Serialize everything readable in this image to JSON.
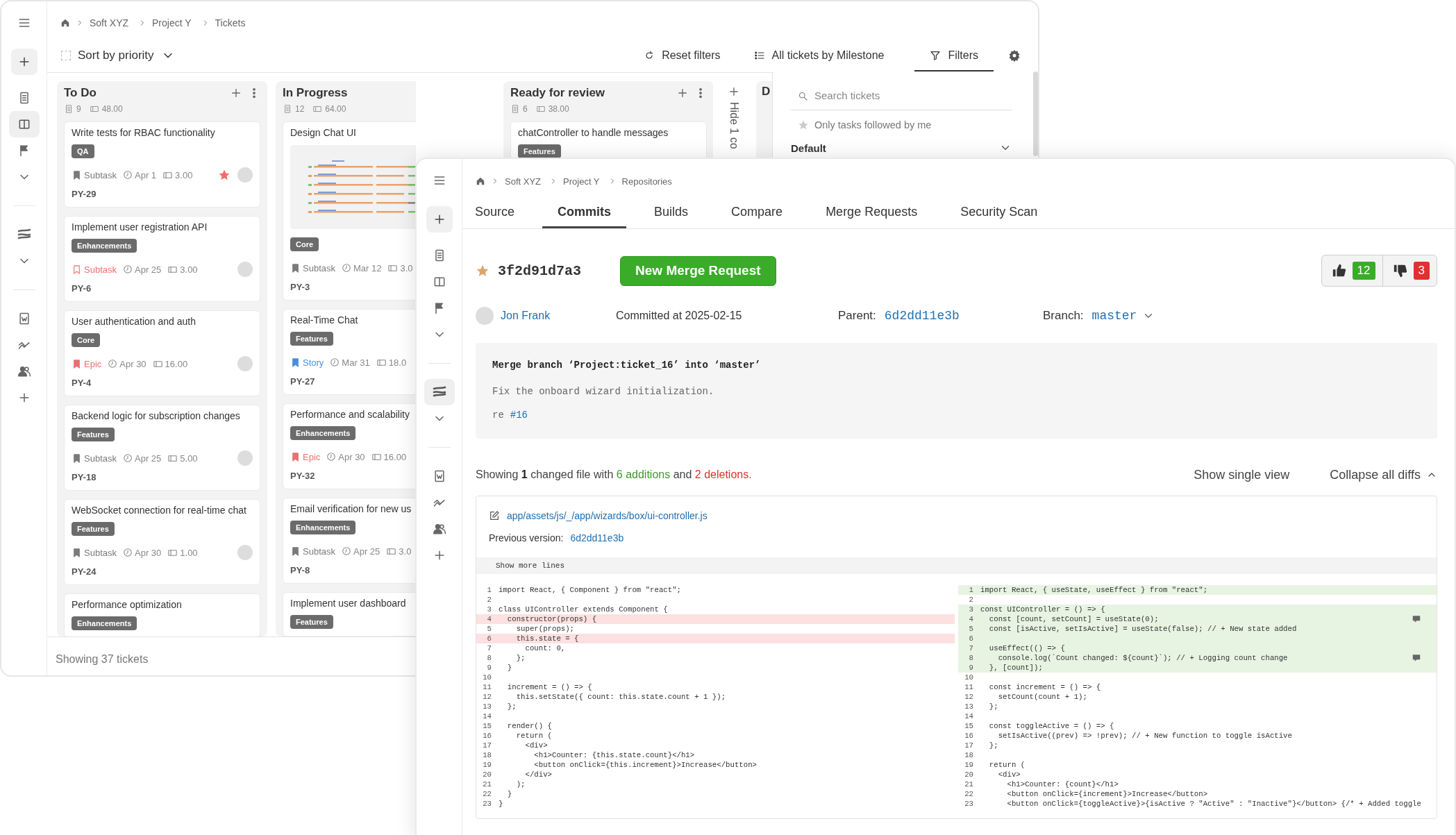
{
  "board_window": {
    "sidebar": {
      "items": [
        {
          "selected": false
        },
        {
          "selected": false
        },
        {
          "selected": false
        },
        {
          "selected": true
        },
        {
          "selected": false
        },
        {
          "selected": false
        },
        {
          "selected": false
        },
        {
          "selected": false
        },
        {
          "selected": false
        },
        {
          "selected": false
        },
        {
          "selected": false
        },
        {
          "selected": false
        }
      ]
    },
    "breadcrumb": [
      "Soft XYZ",
      "Project Y",
      "Tickets"
    ],
    "sort": {
      "label": "Sort by priority",
      "checked": false
    },
    "actions": [
      {
        "label": "Reset filters",
        "selected": false
      },
      {
        "label": "All tickets by Milestone",
        "selected": false
      },
      {
        "label": "Filters",
        "selected": true
      }
    ],
    "columns": [
      {
        "title": "To Do",
        "count": "9",
        "estimate": "48.00",
        "cards": [
          {
            "title": "Write tests for RBAC functionality",
            "tag": "QA",
            "type": {
              "label": "Subtask",
              "color": "#7a7a7a",
              "kind": "filled"
            },
            "date": "Apr 1",
            "estimate": "3.00",
            "starred": true,
            "avatar": true,
            "id": "PY-29"
          },
          {
            "title": "Implement user registration API",
            "tag": "Enhancements",
            "type": {
              "label": "Subtask",
              "color": "#e8706f",
              "kind": "outline"
            },
            "date": "Apr 25",
            "estimate": "3.00",
            "starred": false,
            "avatar": true,
            "id": "PY-6"
          },
          {
            "title": "User authentication and auth",
            "tag": "Core",
            "type": {
              "label": "Epic",
              "color": "#e8706f",
              "kind": "filled"
            },
            "date": "Apr 30",
            "estimate": "16.00",
            "starred": false,
            "avatar": true,
            "id": "PY-4"
          },
          {
            "title": "Backend logic for subscription changes",
            "tag": "Features",
            "type": {
              "label": "Subtask",
              "color": "#7a7a7a",
              "kind": "filled"
            },
            "date": "Apr 25",
            "estimate": "5.00",
            "starred": false,
            "avatar": true,
            "id": "PY-18"
          },
          {
            "title": "WebSocket connection for real-time chat",
            "tag": "Features",
            "type": {
              "label": "Subtask",
              "color": "#7a7a7a",
              "kind": "filled"
            },
            "date": "Apr 30",
            "estimate": "1.00",
            "starred": false,
            "avatar": true,
            "id": "PY-24"
          },
          {
            "title": "Performance optimization",
            "tag": "Enhancements"
          }
        ]
      },
      {
        "title": "In Progress",
        "count": "12",
        "estimate": "64.00",
        "cards": [
          {
            "title": "Design Chat UI",
            "tag": "Core",
            "type": {
              "label": "Subtask",
              "color": "#7a7a7a",
              "kind": "filled"
            },
            "date": "Mar 12",
            "estimate": "3.0",
            "id": "PY-3"
          },
          {
            "title": "Real-Time Chat",
            "tag": "Features",
            "type": {
              "label": "Story",
              "color": "#4a8fd6",
              "kind": "filled"
            },
            "date": "Mar 31",
            "estimate": "18.0",
            "id": "PY-27"
          },
          {
            "title": "Performance and scalability",
            "tag": "Enhancements",
            "type": {
              "label": "Epic",
              "color": "#e8706f",
              "kind": "filled"
            },
            "date": "Apr 30",
            "estimate": "16.00",
            "id": "PY-32"
          },
          {
            "title": "Email verification for new us",
            "tag": "Enhancements",
            "type": {
              "label": "Subtask",
              "color": "#7a7a7a",
              "kind": "filled"
            },
            "date": "Apr 25",
            "estimate": "3.0",
            "id": "PY-8"
          },
          {
            "title": "Implement user dashboard",
            "tag": "Features"
          }
        ]
      },
      {
        "title": "Ready for review",
        "count": "6",
        "estimate": "38.00",
        "cards": [
          {
            "title": "chatController to handle messages",
            "tag": "Features"
          }
        ]
      }
    ],
    "hidden_columns": {
      "label": "Hide 1 co"
    },
    "column_4": {
      "title": "D"
    },
    "filter_panel": {
      "search": {
        "placeholder": "Search tickets"
      },
      "followed_only": {
        "label": "Only tasks followed by me",
        "checked": false
      },
      "section": {
        "label": "Default"
      }
    },
    "footer": "Showing 37 tickets"
  },
  "repo_window": {
    "sidebar": {
      "items": [
        {
          "selected": false
        },
        {
          "selected": false
        },
        {
          "selected": false
        },
        {
          "selected": false
        },
        {
          "selected": false
        },
        {
          "selected": false
        },
        {
          "selected": true
        },
        {
          "selected": false
        },
        {
          "selected": false
        },
        {
          "selected": false
        },
        {
          "selected": false
        },
        {
          "selected": false
        }
      ]
    },
    "breadcrumb": [
      "Soft XYZ",
      "Project Y",
      "Repositories"
    ],
    "tabs": [
      {
        "label": "Source",
        "selected": false
      },
      {
        "label": "Commits",
        "selected": true
      },
      {
        "label": "Builds",
        "selected": false
      },
      {
        "label": "Compare",
        "selected": false
      },
      {
        "label": "Merge Requests",
        "selected": false
      },
      {
        "label": "Security Scan",
        "selected": false
      }
    ],
    "commit": {
      "starred": true,
      "hash": "3f2d91d7a3",
      "button": "New Merge Request",
      "upvotes": "12",
      "downvotes": "3",
      "author": "Jon Frank",
      "committed": "Committed at 2025-02-15",
      "parent_label": "Parent:",
      "parent": "6d2dd11e3b",
      "branch_label": "Branch:",
      "branch": "master"
    },
    "message": {
      "title": "Merge branch ‘Project:ticket_16’ into ‘master’",
      "body": "Fix the onboard wizard initialization.",
      "ref_prefix": "re",
      "ref": "#16"
    },
    "summary": {
      "prefix": "Showing **1** changed file with",
      "additions": "6 additions",
      "joiner": "and",
      "deletions": "2 deletions."
    },
    "view_toggle": "Show single view",
    "collapse": "Collapse all diffs",
    "diff": {
      "path": "app/assets/js/_/app/wizards/box/ui-controller.js",
      "previous_label": "Previous version:",
      "previous": "6d2dd11e3b",
      "show_more": "Show more lines",
      "left": [
        {
          "n": "1",
          "text": "import React, { Component } from \"react\";",
          "kind": "context"
        },
        {
          "n": "2",
          "kind": "context"
        },
        {
          "n": "3",
          "text": "class UIController extends Component {",
          "kind": "context"
        },
        {
          "n": "4",
          "text": "  constructor(props) {",
          "kind": "removed"
        },
        {
          "n": "5",
          "text": "    super(props);",
          "kind": "context"
        },
        {
          "n": "6",
          "text": "    this.state = {",
          "kind": "removed"
        },
        {
          "n": "7",
          "text": "      count: 0,",
          "kind": "context"
        },
        {
          "n": "8",
          "text": "    };",
          "kind": "context"
        },
        {
          "n": "9",
          "text": "  }",
          "kind": "context"
        },
        {
          "n": "10",
          "kind": "context"
        },
        {
          "n": "11",
          "text": "  increment = () => {",
          "kind": "context"
        },
        {
          "n": "12",
          "text": "    this.setState({ count: this.state.count + 1 });",
          "kind": "context"
        },
        {
          "n": "13",
          "text": "  };",
          "kind": "context"
        },
        {
          "n": "14",
          "kind": "context"
        },
        {
          "n": "15",
          "text": "  render() {",
          "kind": "context"
        },
        {
          "n": "16",
          "text": "    return (",
          "kind": "context"
        },
        {
          "n": "17",
          "text": "      <div>",
          "kind": "context"
        },
        {
          "n": "18",
          "text": "        <h1>Counter: {this.state.count}</h1>",
          "kind": "context"
        },
        {
          "n": "19",
          "text": "        <button onClick={this.increment}>Increase</button>",
          "kind": "context"
        },
        {
          "n": "20",
          "text": "      </div>",
          "kind": "context"
        },
        {
          "n": "21",
          "text": "    );",
          "kind": "context"
        },
        {
          "n": "22",
          "text": "  }",
          "kind": "context"
        },
        {
          "n": "23",
          "text": "}",
          "kind": "context"
        }
      ],
      "right": [
        {
          "n": "1",
          "text": "import React, { useState, useEffect } from \"react\";",
          "kind": "added"
        },
        {
          "n": "2",
          "kind": "context"
        },
        {
          "n": "3",
          "text": "const UIController = () => {",
          "kind": "added"
        },
        {
          "n": "4",
          "text": "  const [count, setCount] = useState(0);",
          "kind": "added",
          "comment": true
        },
        {
          "n": "5",
          "text": "  const [isActive, setIsActive] = useState(false); // + New state added",
          "kind": "added"
        },
        {
          "n": "6",
          "kind": "added"
        },
        {
          "n": "7",
          "text": "  useEffect(() => {",
          "kind": "added"
        },
        {
          "n": "8",
          "text": "    console.log(`Count changed: ${count}`); // + Logging count change",
          "kind": "added",
          "comment": true
        },
        {
          "n": "9",
          "text": "  }, [count]);",
          "kind": "added"
        },
        {
          "n": "10",
          "kind": "context"
        },
        {
          "n": "11",
          "text": "  const increment = () => {",
          "kind": "context"
        },
        {
          "n": "12",
          "text": "    setCount(count + 1);",
          "kind": "context"
        },
        {
          "n": "13",
          "text": "  };",
          "kind": "context"
        },
        {
          "n": "14",
          "kind": "context"
        },
        {
          "n": "15",
          "text": "  const toggleActive = () => {",
          "kind": "context"
        },
        {
          "n": "16",
          "text": "    setIsActive((prev) => !prev); // + New function to toggle isActive",
          "kind": "context"
        },
        {
          "n": "17",
          "text": "  };",
          "kind": "context"
        },
        {
          "n": "18",
          "kind": "context"
        },
        {
          "n": "19",
          "text": "  return (",
          "kind": "context"
        },
        {
          "n": "20",
          "text": "    <div>",
          "kind": "context"
        },
        {
          "n": "21",
          "text": "      <h1>Counter: {count}</h1>",
          "kind": "context"
        },
        {
          "n": "22",
          "text": "      <button onClick={increment}>Increase</button>",
          "kind": "context"
        },
        {
          "n": "23",
          "text": "      <button onClick={toggleActive}>{isActive ? \"Active\" : \"Inactive\"}</button> {/* + Added toggle",
          "kind": "context"
        }
      ]
    }
  }
}
